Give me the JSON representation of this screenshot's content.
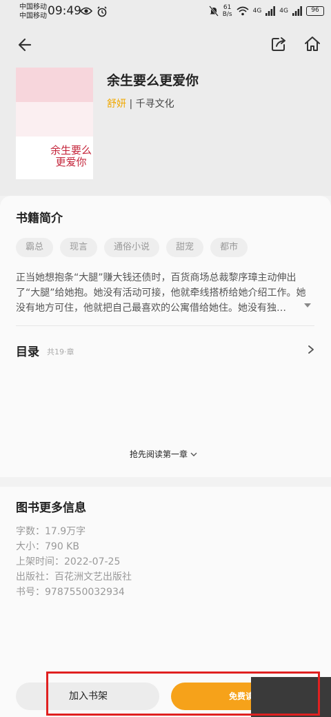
{
  "status_bar": {
    "carrier1": "中国移动",
    "carrier2": "中国移动",
    "time": "09:49",
    "net_speed_value": "61",
    "net_speed_unit": "B/s",
    "signal1_label": "4G",
    "signal2_label": "4G",
    "battery": "96"
  },
  "book": {
    "title": "余生要么更爱你",
    "author": "舒妍",
    "separator": "|",
    "publisher_short": "千寻文化",
    "cover_title": "余生要么更爱你"
  },
  "intro": {
    "heading": "书籍简介",
    "tags": [
      "霸总",
      "现言",
      "通俗小说",
      "甜宠",
      "都市"
    ],
    "text": "正当她想抱条“大腿”赚大钱还债时，百货商场总裁黎序璋主动伸出了“大腿”给她抱。她没有活动可接，他就牵线搭桥给她介绍工作。她没有地方可住，他就把自己最喜欢的公寓借给她住。她没有独…"
  },
  "toc": {
    "heading": "目录",
    "count": "共19·章"
  },
  "preview": {
    "label": "抢先阅读第一章"
  },
  "more_info": {
    "heading": "图书更多信息",
    "word_count": "字数：17.9万字",
    "size": "大小：790 KB",
    "shelf_time": "上架时间：2022-07-25",
    "publisher": "出版社：百花洲文艺出版社",
    "isbn": "书号：9787550032934"
  },
  "bottom": {
    "add_shelf": "加入书架",
    "free_read": "免费读"
  },
  "colors": {
    "accent": "#f6a21a",
    "author": "#f0a800",
    "highlight": "#e02020"
  }
}
